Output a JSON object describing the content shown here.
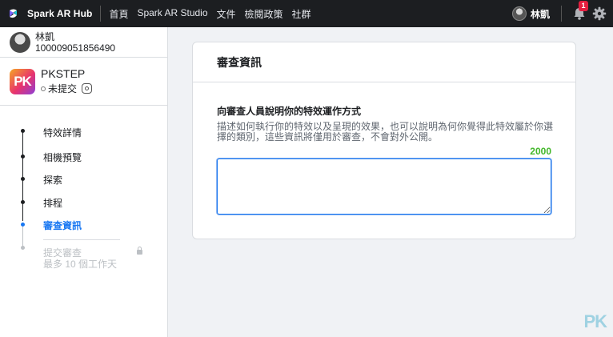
{
  "topbar": {
    "brand": "Spark AR Hub",
    "nav": [
      "首頁",
      "Spark AR Studio",
      "文件",
      "檢閱政策",
      "社群"
    ],
    "user_name": "林凱",
    "notification_count": "1"
  },
  "sidebar": {
    "account": {
      "name": "林凱",
      "id": "100009051856490"
    },
    "effect": {
      "logo_text": "PK",
      "name": "PKSTEP",
      "status": "未提交"
    },
    "steps": [
      {
        "label": "特效詳情"
      },
      {
        "label": "相機預覽"
      },
      {
        "label": "探索"
      },
      {
        "label": "排程"
      },
      {
        "label": "審查資訊"
      }
    ],
    "submit": {
      "label": "提交審查",
      "sub": "最多 10 個工作天"
    }
  },
  "card": {
    "title": "審查資訊",
    "field_label": "向審查人員說明你的特效運作方式",
    "field_desc": "描述如何執行你的特效以及呈現的效果，也可以說明為何你覺得此特效屬於你選擇的類別，這些資訊將僅用於審查，不會對外公開。",
    "char_count": "2000",
    "textarea_value": ""
  },
  "watermark": "PK",
  "colors": {
    "accent": "#1877f2",
    "counter": "#42b72a",
    "topbar": "#1c1e21",
    "badge": "#e41e3f"
  }
}
